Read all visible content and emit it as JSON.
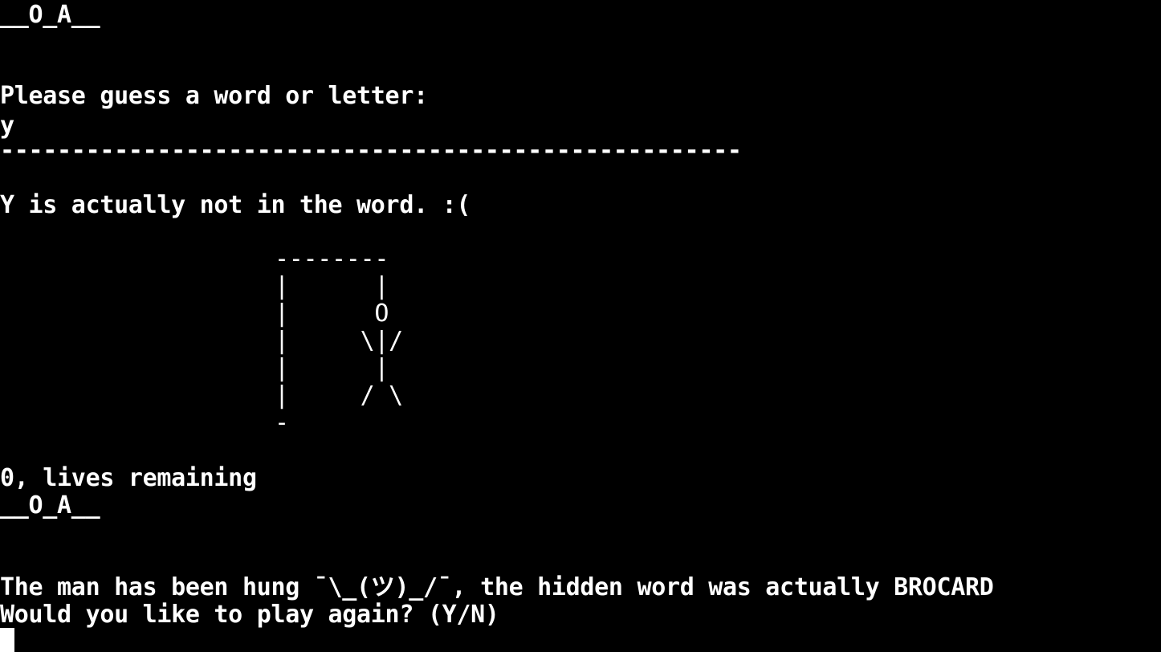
{
  "terminal": {
    "lines": {
      "word_progress_top": "__O_A__",
      "prompt": "Please guess a word or letter:",
      "user_input": "y",
      "separator": "----------------------------------------------------",
      "feedback": "Y is actually not in the word. :(",
      "lives": "0, lives remaining",
      "word_progress_bottom": "__O_A__",
      "result": "The man has been hung ¯\\_(ツ)_/¯, the hidden word was actually BROCARD",
      "play_again": "Would you like to play again? (Y/N)"
    },
    "hangman_art": "--------\n|      |\n|      O\n|     \\|/\n|      |\n|     / \\\n-",
    "colors": {
      "background": "#000000",
      "foreground": "#ffffff"
    }
  }
}
